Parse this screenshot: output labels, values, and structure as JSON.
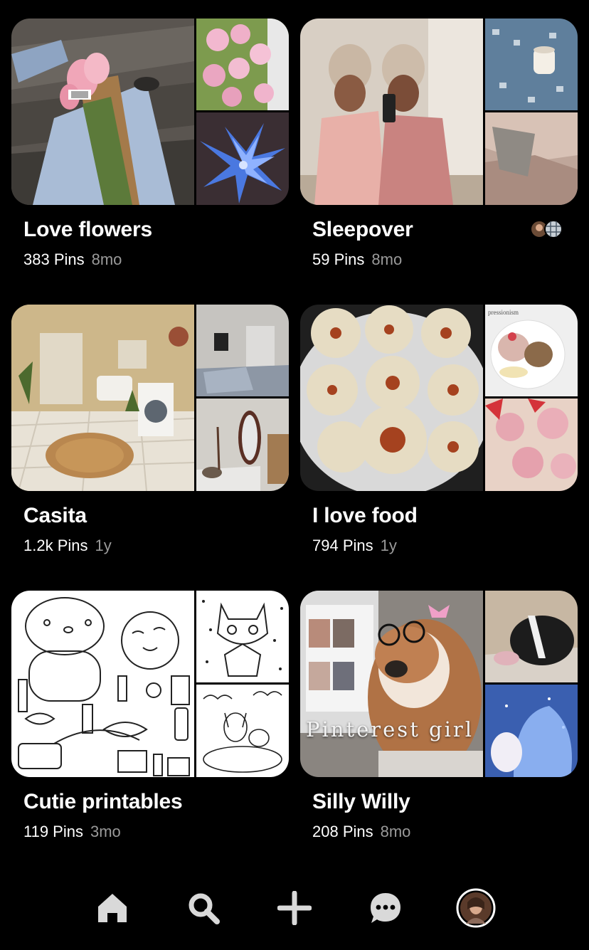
{
  "boards": [
    {
      "title": "Love flowers",
      "count": "383 Pins",
      "age": "8mo"
    },
    {
      "title": "Sleepover",
      "count": "59 Pins",
      "age": "8mo"
    },
    {
      "title": "Casita",
      "count": "1.2k Pins",
      "age": "1y"
    },
    {
      "title": "I love food",
      "count": "794 Pins",
      "age": "1y"
    },
    {
      "title": "Cutie printables",
      "count": "119 Pins",
      "age": "3mo"
    },
    {
      "title": "Silly Willy",
      "count": "208 Pins",
      "age": "8mo"
    }
  ],
  "overlays": {
    "silly_willy_main": "Pinterest girl",
    "food_tr": "pressionism"
  },
  "tabbar": [
    {
      "name": "home",
      "icon": "home-icon"
    },
    {
      "name": "search",
      "icon": "search-icon"
    },
    {
      "name": "create",
      "icon": "plus-icon"
    },
    {
      "name": "messages",
      "icon": "chat-bubble-icon"
    },
    {
      "name": "profile",
      "icon": "avatar"
    }
  ],
  "colors": {
    "background": "#000000",
    "meta_secondary": "#9a9a9a",
    "icon": "#d9d9d9"
  }
}
